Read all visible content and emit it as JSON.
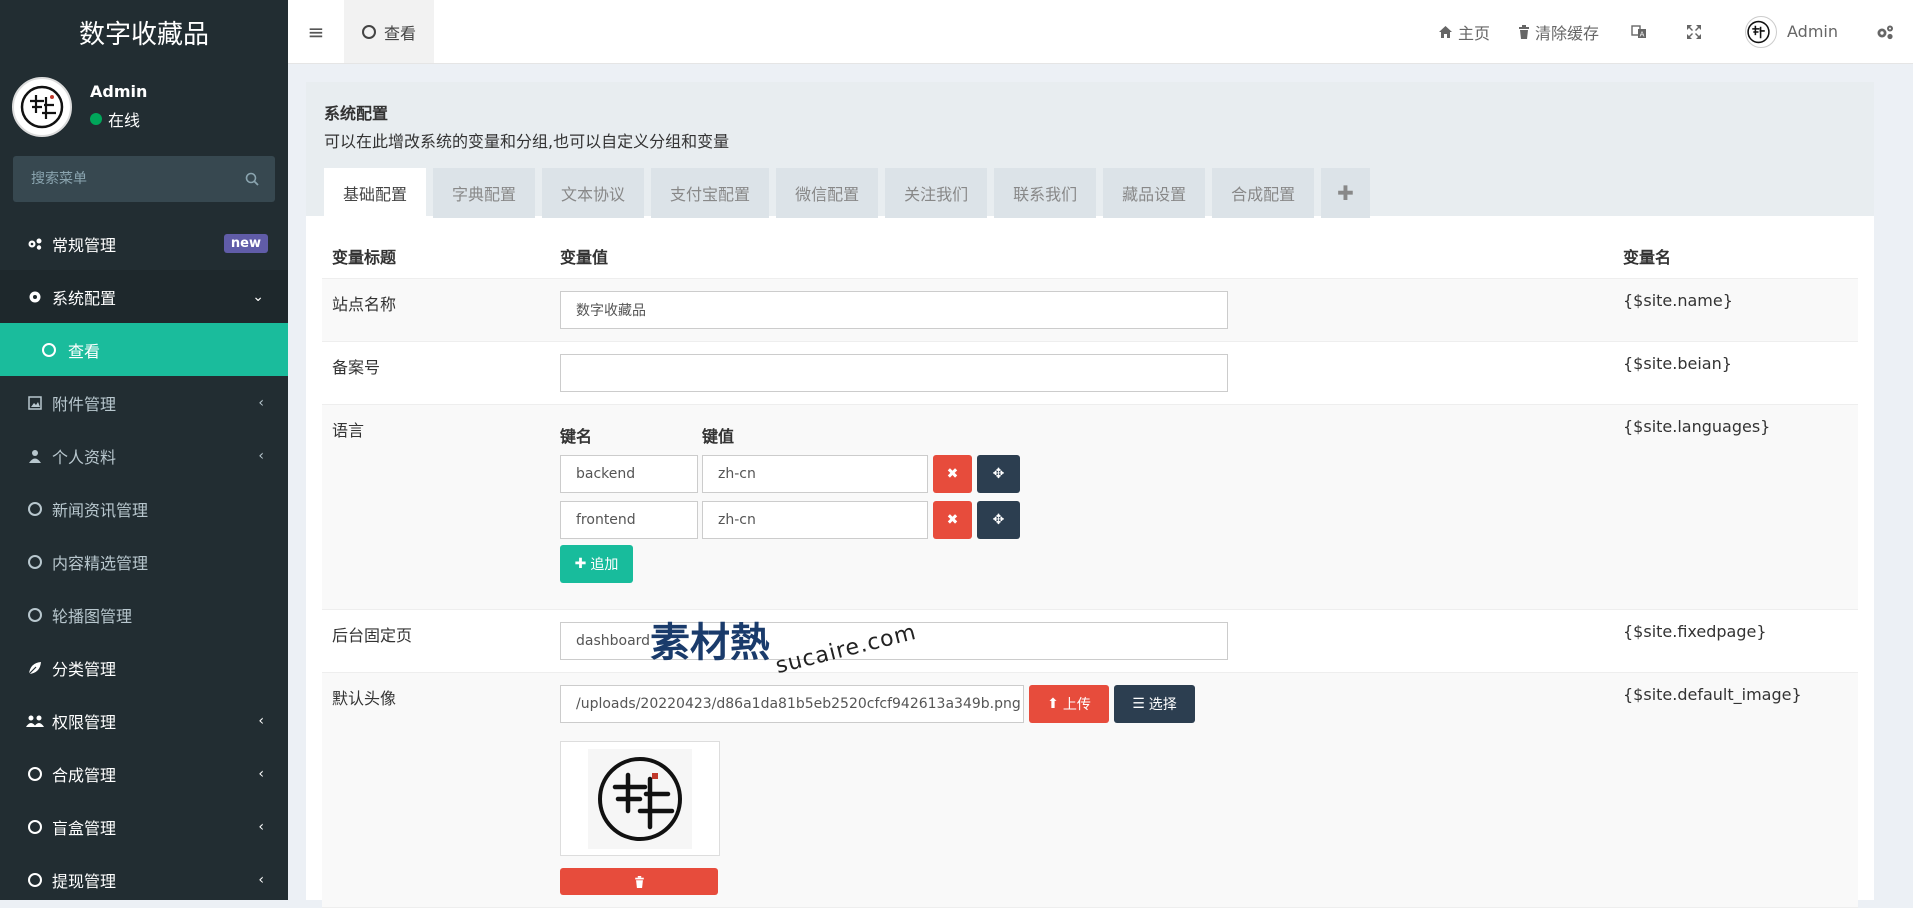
{
  "app": {
    "title": "数字收藏品"
  },
  "user": {
    "name": "Admin",
    "status": "在线"
  },
  "search": {
    "placeholder": "搜索菜单"
  },
  "sidebar": {
    "items": [
      {
        "label": "常规管理",
        "badge": "new"
      },
      {
        "label": "系统配置"
      },
      {
        "label": "查看"
      },
      {
        "label": "附件管理"
      },
      {
        "label": "个人资料"
      },
      {
        "label": "新闻资讯管理"
      },
      {
        "label": "内容精选管理"
      },
      {
        "label": "轮播图管理"
      },
      {
        "label": "分类管理"
      },
      {
        "label": "权限管理"
      },
      {
        "label": "合成管理"
      },
      {
        "label": "盲盒管理"
      },
      {
        "label": "提现管理"
      }
    ]
  },
  "topbar": {
    "tab_label": "查看",
    "home": "主页",
    "clear_cache": "清除缓存",
    "user": "Admin"
  },
  "panel": {
    "title": "系统配置",
    "desc": "可以在此增改系统的变量和分组,也可以自定义分组和变量",
    "tabs": [
      "基础配置",
      "字典配置",
      "文本协议",
      "支付宝配置",
      "微信配置",
      "关注我们",
      "联系我们",
      "藏品设置",
      "合成配置"
    ],
    "plus": "✚"
  },
  "table": {
    "headers": {
      "title": "变量标题",
      "value": "变量值",
      "name": "变量名"
    },
    "rows": {
      "site_name": {
        "title": "站点名称",
        "value": "数字收藏品",
        "var": "{$site.name}"
      },
      "beian": {
        "title": "备案号",
        "value": "",
        "var": "{$site.beian}"
      },
      "languages": {
        "title": "语言",
        "var": "{$site.languages}",
        "key_header": "键名",
        "val_header": "键值",
        "entries": [
          {
            "key": "backend",
            "value": "zh-cn"
          },
          {
            "key": "frontend",
            "value": "zh-cn"
          }
        ],
        "add_label": "追加"
      },
      "fixedpage": {
        "title": "后台固定页",
        "value": "dashboard",
        "var": "{$site.fixedpage}"
      },
      "default_image": {
        "title": "默认头像",
        "value": "/uploads/20220423/d86a1da81b5eb2520cfcf942613a349b.png",
        "var": "{$site.default_image}",
        "upload_label": "上传",
        "choose_label": "选择"
      }
    }
  },
  "watermark": {
    "logo": "素材熱",
    "text": "sucaire.com"
  },
  "colors": {
    "sidebar_bg": "#222d32",
    "accent": "#18bc9c",
    "danger": "#e74c3c",
    "dark": "#2c3e50",
    "badge": "#605ca8"
  }
}
